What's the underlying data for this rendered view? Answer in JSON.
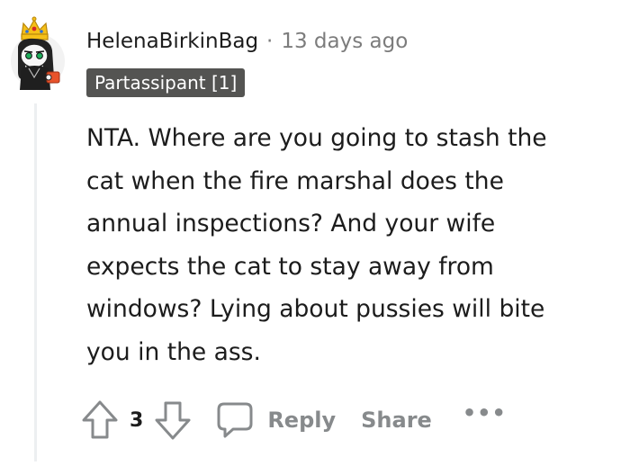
{
  "comment": {
    "author": "HelenaBirkinBag",
    "separator": "·",
    "timestamp": "13 days ago",
    "flair": "Partassipant [1]",
    "body": [
      "NTA. Where are you going to stash the",
      "cat when the fire marshal does the",
      "annual inspections? And your wife",
      "expects the cat to stay away from",
      "windows? Lying about pussies will bite",
      "you in the ass."
    ]
  },
  "actions": {
    "score": "3",
    "reply_label": "Reply",
    "share_label": "Share",
    "more_label": "•••"
  },
  "icons": {
    "upvote": "arrow-up-icon",
    "downvote": "arrow-down-icon",
    "reply": "chat-bubble-icon",
    "avatar": "snoo-avatar-with-crown"
  },
  "colors": {
    "text": "#1c1c1c",
    "meta": "#7c7c7c",
    "action_gray": "#878a8c",
    "flair_bg": "#545452",
    "flair_text": "#ffffff",
    "thread_line": "#edeff1"
  }
}
